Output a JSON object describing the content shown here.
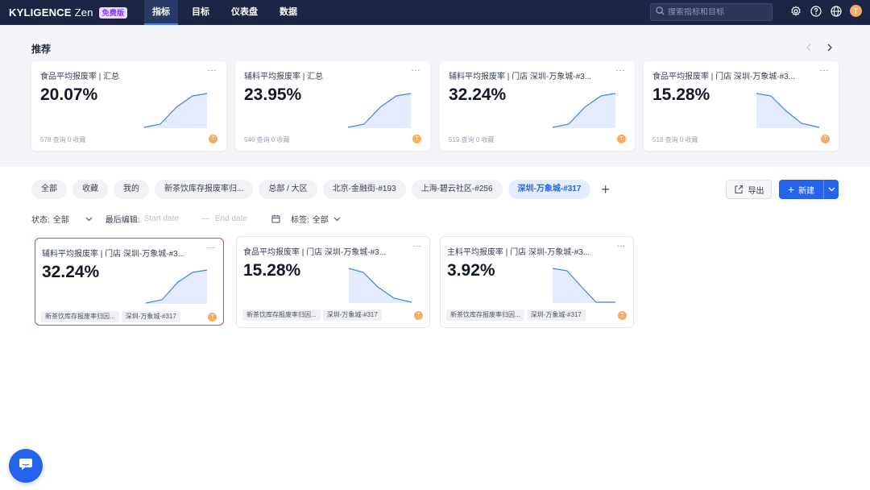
{
  "app": {
    "brand": "KYLIGENCE",
    "brand_suffix": "Zen",
    "plan_badge": "免费版",
    "user_initial": "T"
  },
  "nav": {
    "items": [
      "指标",
      "目标",
      "仪表盘",
      "数据"
    ],
    "active_index": 0
  },
  "search": {
    "placeholder": "搜索指标和目标"
  },
  "icons": {
    "settings": "gear-icon",
    "help": "question-icon",
    "language": "globe-icon"
  },
  "recommend": {
    "title": "推荐",
    "cards": [
      {
        "title": "食品平均报废率 | 汇总",
        "value": "20.07%",
        "footer": "578 查询 0 收藏",
        "trend": "up",
        "owner": "T"
      },
      {
        "title": "辅料平均报废率 | 汇总",
        "value": "23.95%",
        "footer": "546 查询 0 收藏",
        "trend": "up",
        "owner": "T"
      },
      {
        "title": "辅料平均报废率 | 门店 深圳-万象城-#3...",
        "value": "32.24%",
        "footer": "519 查询 0 收藏",
        "trend": "up",
        "owner": "T"
      },
      {
        "title": "食品平均报废率 | 门店 深圳-万象城-#3...",
        "value": "15.28%",
        "footer": "518 查询 0 收藏",
        "trend": "down",
        "owner": "T"
      }
    ]
  },
  "tabs": {
    "items": [
      "全部",
      "收藏",
      "我的",
      "新茶饮库存报废率归...",
      "总部 / 大区",
      "北京-金融街-#193",
      "上海-碧云社区-#256",
      "深圳-万象城-#317"
    ],
    "active_index": 7,
    "add_label": "+"
  },
  "actions": {
    "export_label": "导出",
    "new_label": "新建"
  },
  "filters": {
    "status_label": "状态:",
    "status_value": "全部",
    "last_edit_label": "最后编辑:",
    "start_placeholder": "Start date",
    "end_placeholder": "End date",
    "range_separator": "—",
    "tag_label": "标签:",
    "tag_value": "全部"
  },
  "metrics": [
    {
      "title": "辅料平均报废率 | 门店 深圳-万象城-#3...",
      "value": "32.24%",
      "tags": [
        "新茶饮库存报废率归因...",
        "深圳-万象城-#317"
      ],
      "trend": "up",
      "owner": "T",
      "selected": true
    },
    {
      "title": "食品平均报废率 | 门店 深圳-万象城-#3...",
      "value": "15.28%",
      "tags": [
        "新茶饮库存报废率归因...",
        "深圳-万象城-#317"
      ],
      "trend": "down",
      "owner": "T",
      "selected": false
    },
    {
      "title": "主料平均报废率 | 门店 深圳-万象城-#3...",
      "value": "3.92%",
      "tags": [
        "新茶饮库存报废率归因...",
        "深圳-万象城-#317"
      ],
      "trend": "down-steep",
      "owner": "T",
      "selected": false
    }
  ]
}
